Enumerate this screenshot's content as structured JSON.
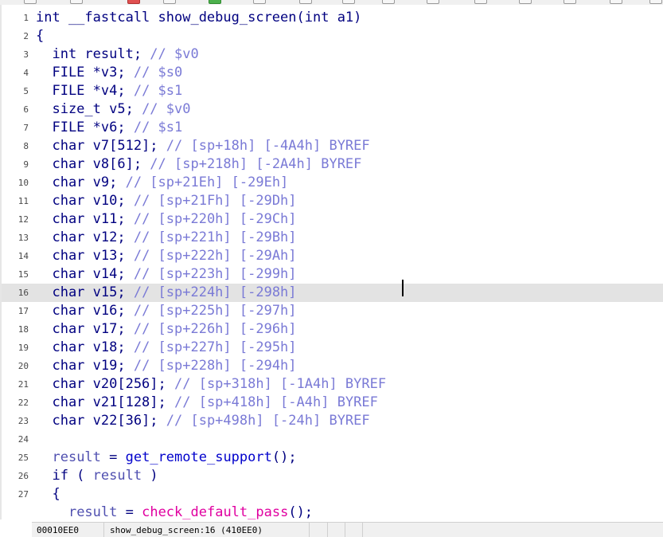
{
  "code_view": {
    "lines": [
      {
        "num": "1",
        "parts": [
          {
            "t": "int __fastcall show_debug_screen(int a1)",
            "c": ""
          }
        ]
      },
      {
        "num": "2",
        "parts": [
          {
            "t": "{",
            "c": ""
          }
        ]
      },
      {
        "num": "3",
        "parts": [
          {
            "t": "  int result; ",
            "c": ""
          },
          {
            "t": "// $v0",
            "c": "cm"
          }
        ]
      },
      {
        "num": "4",
        "parts": [
          {
            "t": "  FILE *v3; ",
            "c": ""
          },
          {
            "t": "// $s0",
            "c": "cm"
          }
        ]
      },
      {
        "num": "5",
        "parts": [
          {
            "t": "  FILE *v4; ",
            "c": ""
          },
          {
            "t": "// $s1",
            "c": "cm"
          }
        ]
      },
      {
        "num": "6",
        "parts": [
          {
            "t": "  size_t v5; ",
            "c": ""
          },
          {
            "t": "// $v0",
            "c": "cm"
          }
        ]
      },
      {
        "num": "7",
        "parts": [
          {
            "t": "  FILE *v6; ",
            "c": ""
          },
          {
            "t": "// $s1",
            "c": "cm"
          }
        ]
      },
      {
        "num": "8",
        "parts": [
          {
            "t": "  char v7[512]; ",
            "c": "dim"
          },
          {
            "t": "// [sp+18h] [-4A4h] BYREF",
            "c": "cm"
          }
        ]
      },
      {
        "num": "9",
        "parts": [
          {
            "t": "  char v8[6]; ",
            "c": "dim"
          },
          {
            "t": "// [sp+218h] [-2A4h] BYREF",
            "c": "cm"
          }
        ]
      },
      {
        "num": "10",
        "parts": [
          {
            "t": "  char v9; ",
            "c": "dim"
          },
          {
            "t": "// [sp+21Eh] [-29Eh]",
            "c": "cm"
          }
        ]
      },
      {
        "num": "11",
        "parts": [
          {
            "t": "  char v10; ",
            "c": "dim"
          },
          {
            "t": "// [sp+21Fh] [-29Dh]",
            "c": "cm"
          }
        ]
      },
      {
        "num": "12",
        "parts": [
          {
            "t": "  char v11; ",
            "c": "dim"
          },
          {
            "t": "// [sp+220h] [-29Ch]",
            "c": "cm"
          }
        ]
      },
      {
        "num": "13",
        "parts": [
          {
            "t": "  char v12; ",
            "c": "dim"
          },
          {
            "t": "// [sp+221h] [-29Bh]",
            "c": "cm"
          }
        ]
      },
      {
        "num": "14",
        "parts": [
          {
            "t": "  char v13; ",
            "c": "dim"
          },
          {
            "t": "// [sp+222h] [-29Ah]",
            "c": "cm"
          }
        ]
      },
      {
        "num": "15",
        "parts": [
          {
            "t": "  char v14; ",
            "c": "dim"
          },
          {
            "t": "// [sp+223h] [-299h]",
            "c": "cm"
          }
        ]
      },
      {
        "num": "16",
        "parts": [
          {
            "t": "  char v15; ",
            "c": "dim"
          },
          {
            "t": "// [sp+224h] [-298h]",
            "c": "cm"
          }
        ]
      },
      {
        "num": "17",
        "parts": [
          {
            "t": "  char v16; ",
            "c": "dim"
          },
          {
            "t": "// [sp+225h] [-297h]",
            "c": "cm"
          }
        ]
      },
      {
        "num": "18",
        "parts": [
          {
            "t": "  char v17; ",
            "c": "dim"
          },
          {
            "t": "// [sp+226h] [-296h]",
            "c": "cm"
          }
        ]
      },
      {
        "num": "19",
        "parts": [
          {
            "t": "  char v18; ",
            "c": "dim"
          },
          {
            "t": "// [sp+227h] [-295h]",
            "c": "cm"
          }
        ]
      },
      {
        "num": "20",
        "parts": [
          {
            "t": "  char v19; ",
            "c": "dim"
          },
          {
            "t": "// [sp+228h] [-294h]",
            "c": "cm"
          }
        ]
      },
      {
        "num": "21",
        "parts": [
          {
            "t": "  char v20[256]; ",
            "c": "dim"
          },
          {
            "t": "// [sp+318h] [-1A4h] BYREF",
            "c": "cm"
          }
        ]
      },
      {
        "num": "22",
        "parts": [
          {
            "t": "  char v21[128]; ",
            "c": "dim"
          },
          {
            "t": "// [sp+418h] [-A4h] BYREF",
            "c": "cm"
          }
        ]
      },
      {
        "num": "23",
        "parts": [
          {
            "t": "  char v22[36]; ",
            "c": "dim"
          },
          {
            "t": "// [sp+498h] [-24h] BYREF",
            "c": "cm"
          }
        ]
      },
      {
        "num": "24",
        "parts": [
          {
            "t": "",
            "c": ""
          }
        ]
      },
      {
        "num": "25",
        "parts": [
          {
            "t": "  ",
            "c": ""
          },
          {
            "t": "result",
            "c": "var"
          },
          {
            "t": " = ",
            "c": ""
          },
          {
            "t": "get_remote_support",
            "c": "fn"
          },
          {
            "t": "();",
            "c": ""
          }
        ]
      },
      {
        "num": "26",
        "parts": [
          {
            "t": "  if ( ",
            "c": ""
          },
          {
            "t": "result",
            "c": "var"
          },
          {
            "t": " )",
            "c": ""
          }
        ]
      },
      {
        "num": "27",
        "parts": [
          {
            "t": "  {",
            "c": ""
          }
        ]
      },
      {
        "num": "",
        "parts": [
          {
            "t": "    ",
            "c": ""
          },
          {
            "t": "result",
            "c": "var"
          },
          {
            "t": " = ",
            "c": ""
          },
          {
            "t": "check_default_pass",
            "c": "ff"
          },
          {
            "t": "();",
            "c": ""
          }
        ]
      }
    ],
    "current_line_index": 15
  },
  "status_bar": {
    "address": "00010EE0",
    "location": "show_debug_screen:16 (410EE0)"
  }
}
